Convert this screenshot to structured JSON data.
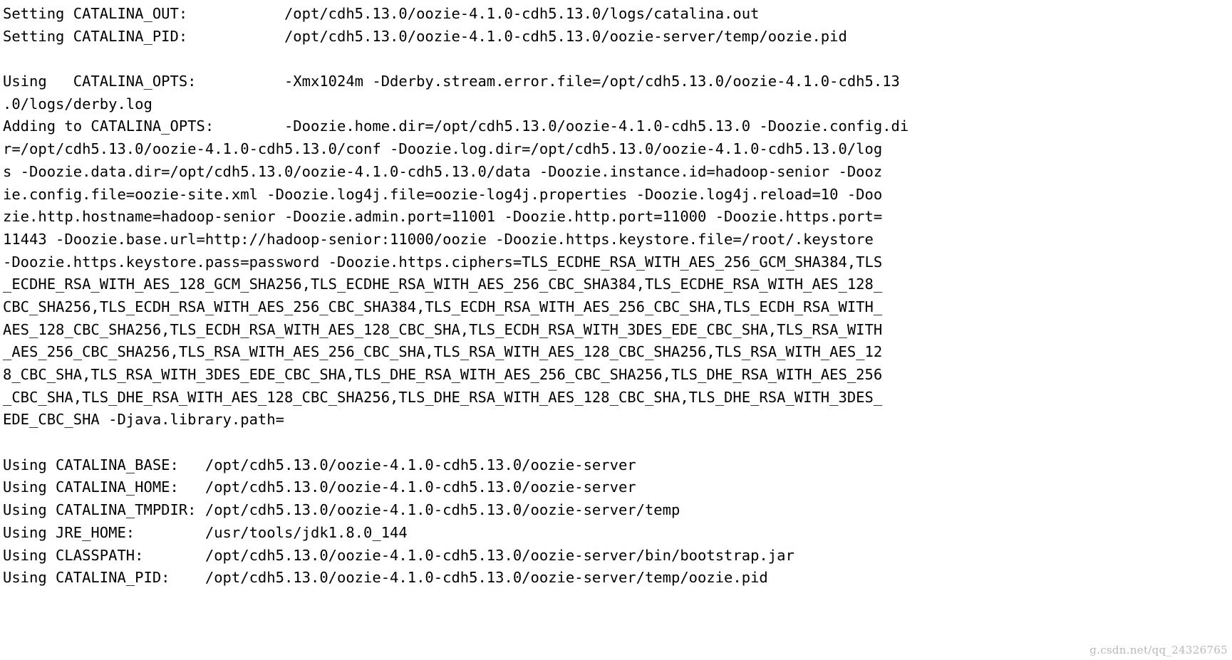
{
  "terminal": {
    "background_color": "#ffffff",
    "foreground_color": "#000000",
    "watermark": "g.csdn.net/qq_24326765",
    "lines": [
      "Setting CATALINA_OUT:           /opt/cdh5.13.0/oozie-4.1.0-cdh5.13.0/logs/catalina.out",
      "Setting CATALINA_PID:           /opt/cdh5.13.0/oozie-4.1.0-cdh5.13.0/oozie-server/temp/oozie.pid",
      "",
      "Using   CATALINA_OPTS:          -Xmx1024m -Dderby.stream.error.file=/opt/cdh5.13.0/oozie-4.1.0-cdh5.13",
      ".0/logs/derby.log",
      "Adding to CATALINA_OPTS:        -Doozie.home.dir=/opt/cdh5.13.0/oozie-4.1.0-cdh5.13.0 -Doozie.config.di",
      "r=/opt/cdh5.13.0/oozie-4.1.0-cdh5.13.0/conf -Doozie.log.dir=/opt/cdh5.13.0/oozie-4.1.0-cdh5.13.0/log",
      "s -Doozie.data.dir=/opt/cdh5.13.0/oozie-4.1.0-cdh5.13.0/data -Doozie.instance.id=hadoop-senior -Dooz",
      "ie.config.file=oozie-site.xml -Doozie.log4j.file=oozie-log4j.properties -Doozie.log4j.reload=10 -Doo",
      "zie.http.hostname=hadoop-senior -Doozie.admin.port=11001 -Doozie.http.port=11000 -Doozie.https.port=",
      "11443 -Doozie.base.url=http://hadoop-senior:11000/oozie -Doozie.https.keystore.file=/root/.keystore",
      "-Doozie.https.keystore.pass=password -Doozie.https.ciphers=TLS_ECDHE_RSA_WITH_AES_256_GCM_SHA384,TLS",
      "_ECDHE_RSA_WITH_AES_128_GCM_SHA256,TLS_ECDHE_RSA_WITH_AES_256_CBC_SHA384,TLS_ECDHE_RSA_WITH_AES_128_",
      "CBC_SHA256,TLS_ECDH_RSA_WITH_AES_256_CBC_SHA384,TLS_ECDH_RSA_WITH_AES_256_CBC_SHA,TLS_ECDH_RSA_WITH_",
      "AES_128_CBC_SHA256,TLS_ECDH_RSA_WITH_AES_128_CBC_SHA,TLS_ECDH_RSA_WITH_3DES_EDE_CBC_SHA,TLS_RSA_WITH",
      "_AES_256_CBC_SHA256,TLS_RSA_WITH_AES_256_CBC_SHA,TLS_RSA_WITH_AES_128_CBC_SHA256,TLS_RSA_WITH_AES_12",
      "8_CBC_SHA,TLS_RSA_WITH_3DES_EDE_CBC_SHA,TLS_DHE_RSA_WITH_AES_256_CBC_SHA256,TLS_DHE_RSA_WITH_AES_256",
      "_CBC_SHA,TLS_DHE_RSA_WITH_AES_128_CBC_SHA256,TLS_DHE_RSA_WITH_AES_128_CBC_SHA,TLS_DHE_RSA_WITH_3DES_",
      "EDE_CBC_SHA -Djava.library.path=",
      "",
      "Using CATALINA_BASE:   /opt/cdh5.13.0/oozie-4.1.0-cdh5.13.0/oozie-server",
      "Using CATALINA_HOME:   /opt/cdh5.13.0/oozie-4.1.0-cdh5.13.0/oozie-server",
      "Using CATALINA_TMPDIR: /opt/cdh5.13.0/oozie-4.1.0-cdh5.13.0/oozie-server/temp",
      "Using JRE_HOME:        /usr/tools/jdk1.8.0_144",
      "Using CLASSPATH:       /opt/cdh5.13.0/oozie-4.1.0-cdh5.13.0/oozie-server/bin/bootstrap.jar",
      "Using CATALINA_PID:    /opt/cdh5.13.0/oozie-4.1.0-cdh5.13.0/oozie-server/temp/oozie.pid"
    ]
  }
}
